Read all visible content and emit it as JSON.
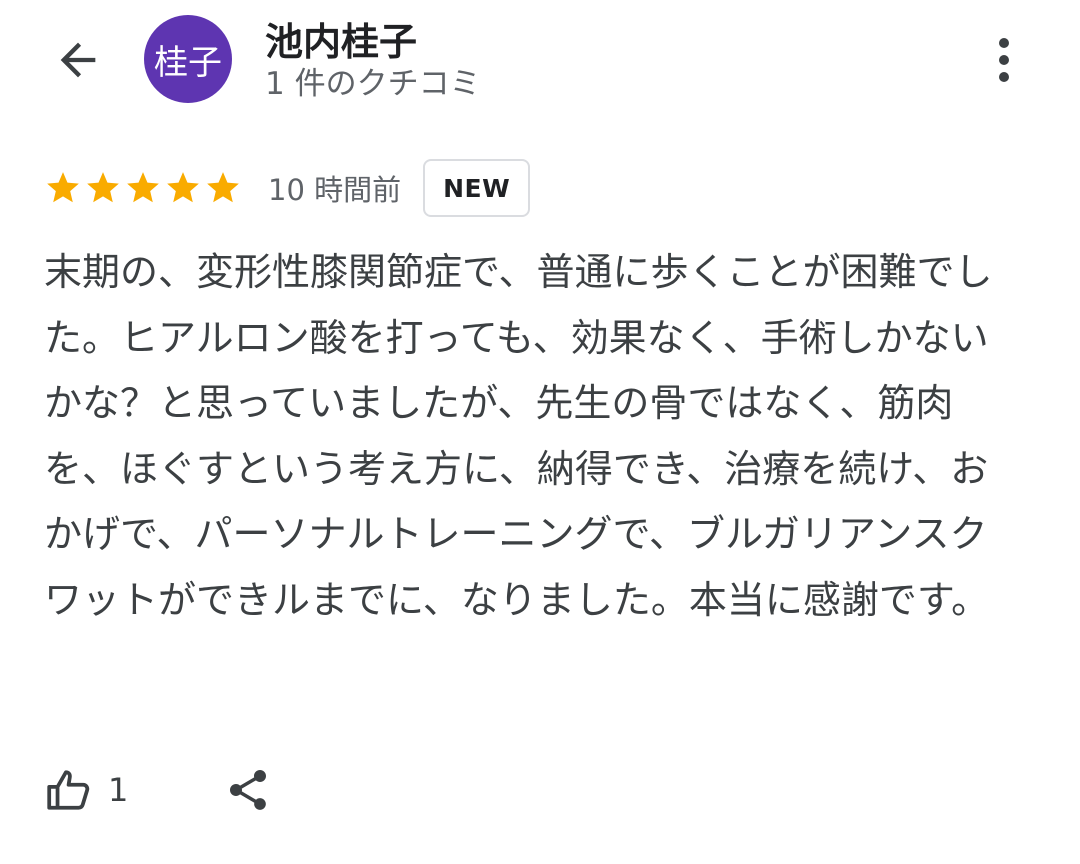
{
  "header": {
    "back_icon": "arrow-back-icon",
    "avatar_text": "桂子",
    "avatar_color": "#5e35b1",
    "name": "池内桂子",
    "subtitle": "1 件のクチコミ",
    "more_icon": "more-vert-icon"
  },
  "review": {
    "rating": 5,
    "rating_max": 5,
    "star_color": "#f9ab00",
    "time": "10 時間前",
    "badge": "NEW",
    "text": "末期の、変形性膝関節症で、普通に歩くことが困難でした。ヒアルロン酸を打っても、効果なく、手術しかないかな？と思っていましたが、先生の骨ではなく、筋肉を、ほぐすという考え方に、納得でき、治療を続け、おかげで、パーソナルトレーニングで、ブルガリアンスクワットができルまでに、なりました。本当に感謝です。"
  },
  "actions": {
    "like_icon": "thumb-up-icon",
    "like_count": "1",
    "share_icon": "share-icon"
  }
}
